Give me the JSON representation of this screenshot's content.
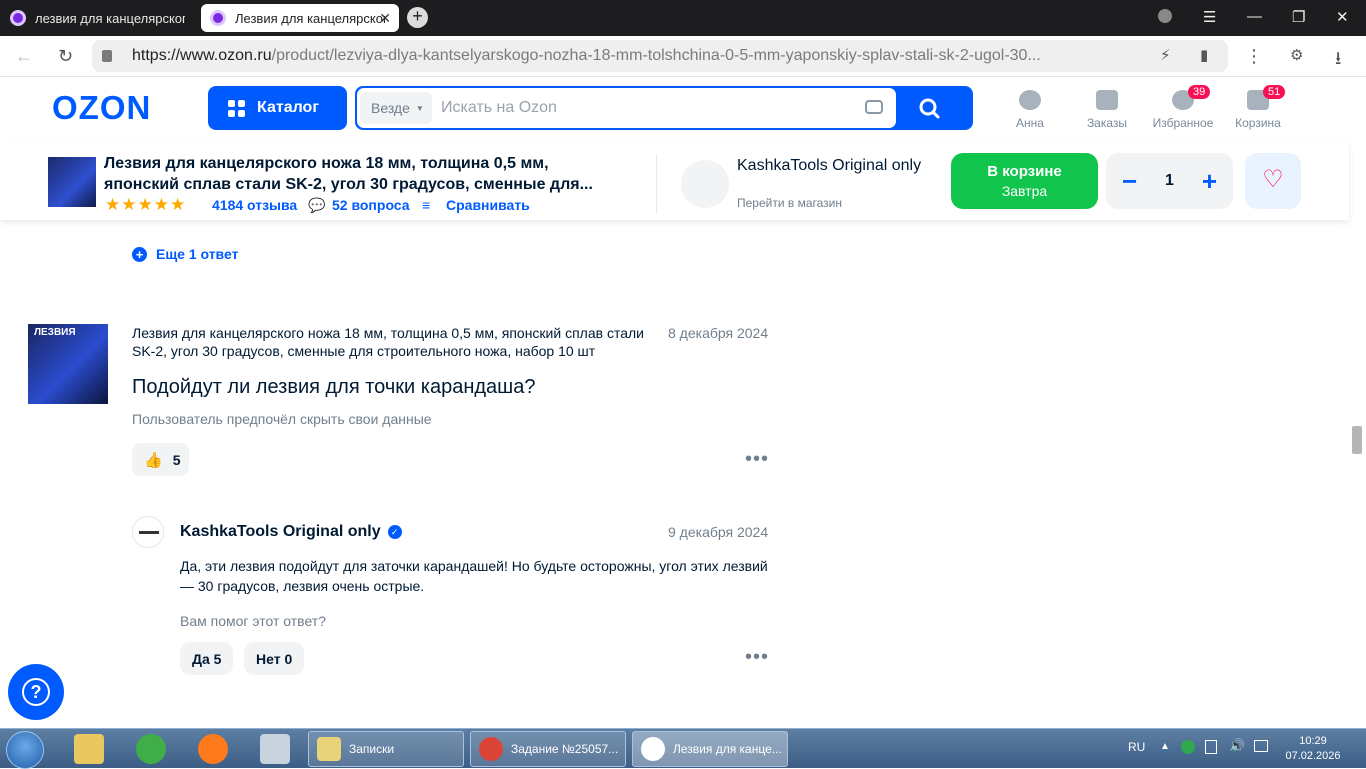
{
  "browser": {
    "tabs": [
      {
        "title": "лезвия для канцелярского ножа"
      },
      {
        "title": "Лезвия для канцелярского ножа",
        "close": "✕"
      }
    ],
    "new_tab": "+",
    "url_host": "https://www.ozon.ru",
    "url_path": "/product/lezviya-dlya-kantselyarskogo-nozha-18-mm-tolshchina-0-5-mm-yaponskiy-splav-stali-sk-2-ugol-30...",
    "window_controls": {
      "menu": "☰",
      "minimize": "—",
      "restore": "❐",
      "close": "✕"
    }
  },
  "header": {
    "logo": "OZON",
    "catalog": "Каталог",
    "search_scope": "Везде",
    "search_placeholder": "Искать на Ozon",
    "nav": [
      {
        "label": "Анна",
        "icon": "user-icon"
      },
      {
        "label": "Заказы",
        "icon": "box-icon"
      },
      {
        "label": "Избранное",
        "icon": "heart-icon",
        "badge": "39"
      },
      {
        "label": "Корзина",
        "icon": "cart-icon",
        "badge": "51"
      }
    ]
  },
  "sticky": {
    "product_title": "Лезвия для канцелярского ножа 18 мм, толщина 0,5 мм, японский сплав стали SK-2, угол 30 градусов, сменные для...",
    "stars": "★★★★★",
    "reviews": "4184 отзыва",
    "questions": "52 вопроса",
    "compare": "Сравнивать",
    "seller_name": "KashkaTools Original only",
    "seller_link": "Перейти в магазин",
    "cart_line1": "В корзине",
    "cart_line2": "Завтра",
    "minus": "−",
    "quantity": "1",
    "plus": "+",
    "favorite": "♡"
  },
  "content": {
    "more_answers": "Еще 1 ответ",
    "question": {
      "thumb_text": "ЛЕЗВИЯ",
      "product": "Лезвия для канцелярского ножа 18 мм, толщина 0,5 мм, японский сплав стали SK-2, угол 30 градусов, сменные для строительного ножа, набор 10 шт",
      "date": "8 декабря 2024",
      "text": "Подойдут ли лезвия для точки карандаша?",
      "user": "Пользователь предпочёл скрыть свои данные",
      "likes": "5",
      "dots": "•••"
    },
    "answer": {
      "author": "KashkaTools Original only",
      "date": "9 декабря 2024",
      "text": "Да, эти лезвия подойдут для заточки карандашей! Но будьте осторожны, угол этих лезвий — 30 градусов, лезвия очень острые.",
      "helpful_question": "Вам помог этот ответ?",
      "yes": "Да 5",
      "no": "Нет 0",
      "dots": "•••"
    }
  },
  "help_button": "?",
  "taskbar": {
    "tasks": [
      {
        "label": "Записки",
        "color": "#e8d37a"
      },
      {
        "label": "Задание №25057...",
        "color": "#db4437"
      },
      {
        "label": "Лезвия для канце...",
        "color": "#ffffff"
      }
    ],
    "lang": "RU",
    "time": "10:29",
    "date": "07.02.2026"
  }
}
